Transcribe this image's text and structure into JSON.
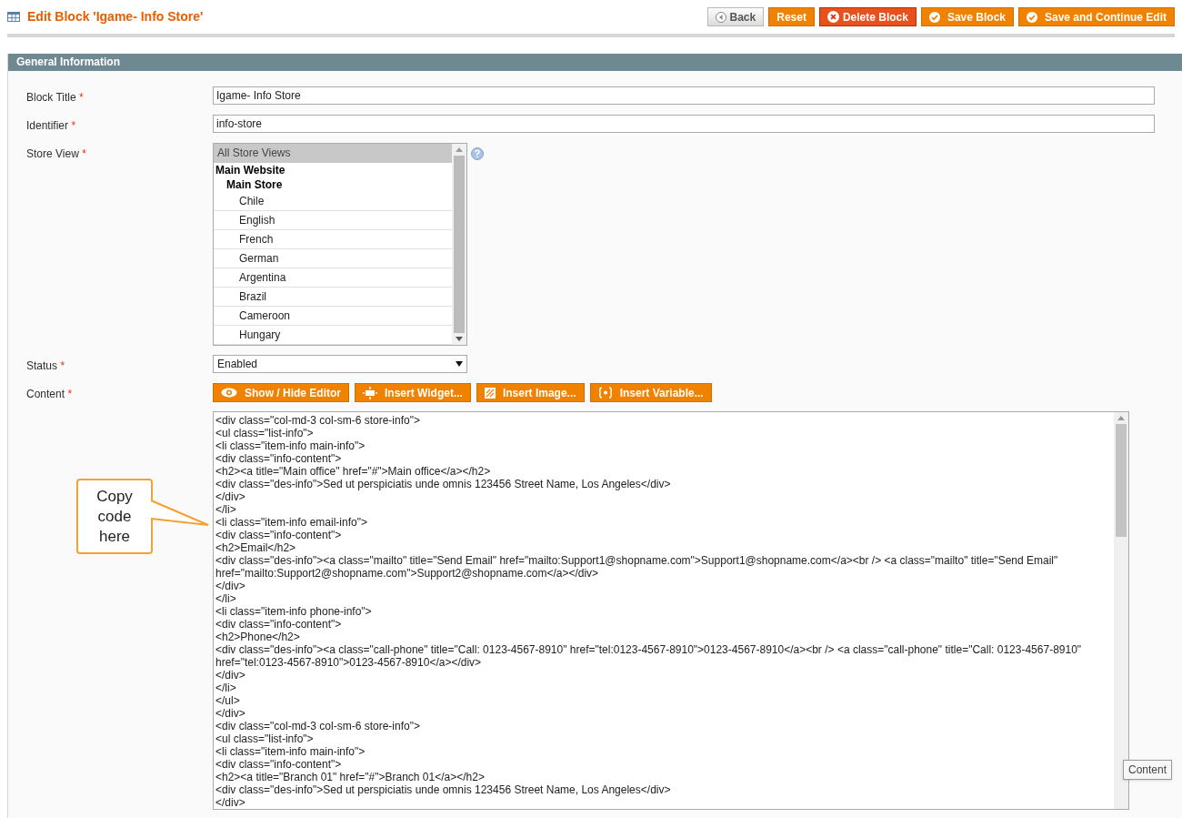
{
  "page": {
    "title": "Edit Block 'Igame- Info Store'"
  },
  "actions": [
    {
      "label": "Back",
      "kind": "back"
    },
    {
      "label": "Reset",
      "kind": "plain"
    },
    {
      "label": "Delete Block",
      "kind": "delete"
    },
    {
      "label": "Save Block",
      "kind": "save"
    },
    {
      "label": "Save and Continue Edit",
      "kind": "save"
    }
  ],
  "section": {
    "title": "General Information"
  },
  "fields": [
    {
      "label": "Block Title",
      "required_mark": "*",
      "kind": "text",
      "value": "Igame- Info Store"
    },
    {
      "label": "Identifier",
      "required_mark": "*",
      "kind": "text",
      "value": "info-store"
    },
    {
      "label": "Store View",
      "required_mark": "*",
      "kind": "multiselect"
    },
    {
      "label": "Status",
      "required_mark": "*",
      "kind": "select",
      "value": "Enabled"
    },
    {
      "label": "Content",
      "required_mark": "*",
      "kind": "editor"
    }
  ],
  "store_view": {
    "options": [
      {
        "label": "All Store Views",
        "selected": true
      }
    ],
    "groups": [
      {
        "label": "Main Website",
        "children": [
          {
            "label": "Main Store",
            "children": [
              {
                "label": "Chile",
                "selected": false
              },
              {
                "label": "English",
                "selected": false
              },
              {
                "label": "French",
                "selected": false
              },
              {
                "label": "German",
                "selected": false
              },
              {
                "label": "Argentina",
                "selected": false
              },
              {
                "label": "Brazil",
                "selected": false
              },
              {
                "label": "Cameroon",
                "selected": false
              },
              {
                "label": "Hungary",
                "selected": false
              }
            ]
          }
        ]
      }
    ]
  },
  "editor_buttons": [
    {
      "label": "Show / Hide Editor",
      "kind": "eye"
    },
    {
      "label": "Insert Widget...",
      "kind": "widget"
    },
    {
      "label": "Insert Image...",
      "kind": "image"
    },
    {
      "label": "Insert Variable...",
      "kind": "variable"
    }
  ],
  "content_lines": [
    "<div class=\"col-md-3 col-sm-6 store-info\">",
    "<ul class=\"list-info\">",
    "<li class=\"item-info main-info\">",
    "<div class=\"info-content\">",
    "<h2><a title=\"Main office\" href=\"#\">Main office</a></h2>",
    "<div class=\"des-info\">Sed ut perspiciatis unde omnis 123456 Street Name, Los Angeles</div>",
    "</div>",
    "</li>",
    "<li class=\"item-info email-info\">",
    "<div class=\"info-content\">",
    "<h2>Email</h2>",
    "<div class=\"des-info\"><a class=\"mailto\" title=\"Send Email\" href=\"mailto:Support1@shopname.com\">Support1@shopname.com</a><br /> <a class=\"mailto\" title=\"Send Email\"",
    "href=\"mailto:Support2@shopname.com\">Support2@shopname.com</a></div>",
    "</div>",
    "</li>",
    "<li class=\"item-info phone-info\">",
    "<div class=\"info-content\">",
    "<h2>Phone</h2>",
    "<div class=\"des-info\"><a class=\"call-phone\" title=\"Call: 0123-4567-8910\" href=\"tel:0123-4567-8910\">0123-4567-8910</a><br /> <a class=\"call-phone\" title=\"Call: 0123-4567-8910\"",
    "href=\"tel:0123-4567-8910\">0123-4567-8910</a></div>",
    "</div>",
    "</li>",
    "</ul>",
    "</div>",
    "<div class=\"col-md-3 col-sm-6 store-info\">",
    "<ul class=\"list-info\">",
    "<li class=\"item-info main-info\">",
    "<div class=\"info-content\">",
    "<h2><a title=\"Branch 01\" href=\"#\">Branch 01</a></h2>",
    "<div class=\"des-info\">Sed ut perspiciatis unde omnis 123456 Street Name, Los Angeles</div>",
    "</div>"
  ],
  "callout": {
    "text": "Copy code here"
  },
  "tooltip": {
    "text": "Content"
  }
}
